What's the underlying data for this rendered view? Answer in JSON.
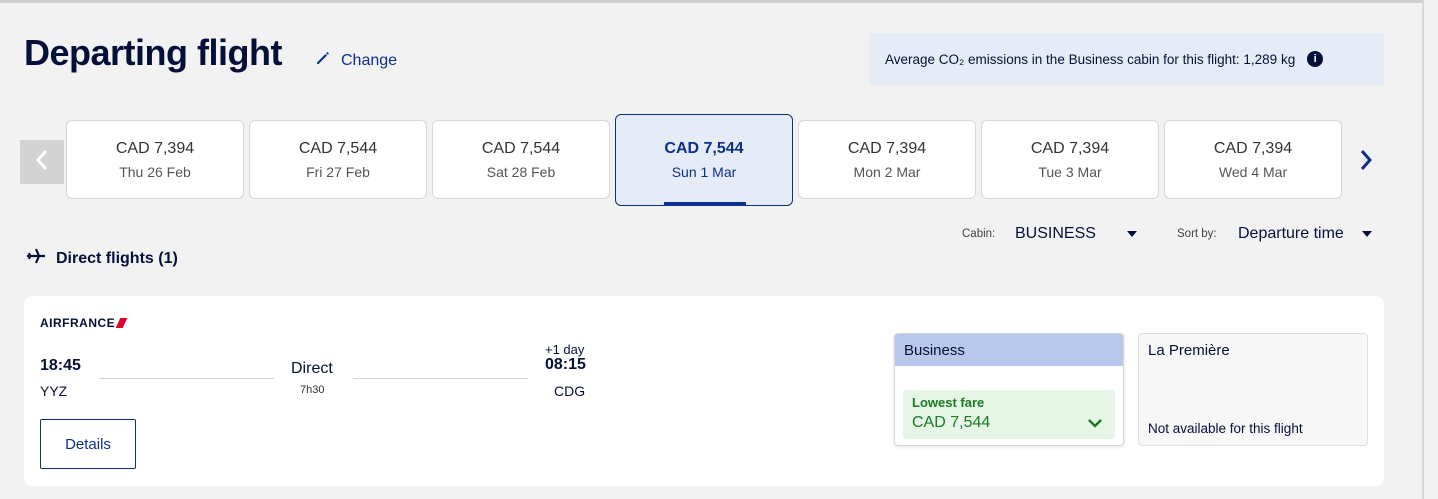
{
  "header": {
    "title": "Departing flight",
    "change_label": "Change",
    "co2_text": "Average CO₂ emissions in the Business cabin for this flight: 1,289 kg",
    "info_glyph": "i"
  },
  "date_carousel": {
    "dates": [
      {
        "price": "CAD 7,394",
        "day": "Thu 26 Feb",
        "selected": false
      },
      {
        "price": "CAD 7,544",
        "day": "Fri 27 Feb",
        "selected": false
      },
      {
        "price": "CAD 7,544",
        "day": "Sat 28 Feb",
        "selected": false
      },
      {
        "price": "CAD 7,544",
        "day": "Sun 1 Mar",
        "selected": true
      },
      {
        "price": "CAD 7,394",
        "day": "Mon 2 Mar",
        "selected": false
      },
      {
        "price": "CAD 7,394",
        "day": "Tue 3 Mar",
        "selected": false
      },
      {
        "price": "CAD 7,394",
        "day": "Wed 4 Mar",
        "selected": false
      }
    ]
  },
  "filters": {
    "cabin_label": "Cabin:",
    "cabin_value": "BUSINESS",
    "sort_label": "Sort by:",
    "sort_value": "Departure time"
  },
  "results": {
    "heading": "Direct flights (1)"
  },
  "flight": {
    "airline": "AIRFRANCE",
    "departure_time": "18:45",
    "departure_airport": "YYZ",
    "stops": "Direct",
    "duration": "7h30",
    "day_offset": "+1 day",
    "arrival_time": "08:15",
    "arrival_airport": "CDG",
    "details_label": "Details"
  },
  "fares": {
    "business": {
      "name": "Business",
      "tag": "Lowest fare",
      "price": "CAD 7,544"
    },
    "premiere": {
      "name": "La Première",
      "status": "Not available for this flight"
    }
  },
  "colors": {
    "brand_navy": "#051039",
    "link_blue": "#0b2f8a",
    "fare_green": "#1c7b24",
    "selected_bg": "#e6ecf7",
    "airline_red": "#e4002b"
  }
}
